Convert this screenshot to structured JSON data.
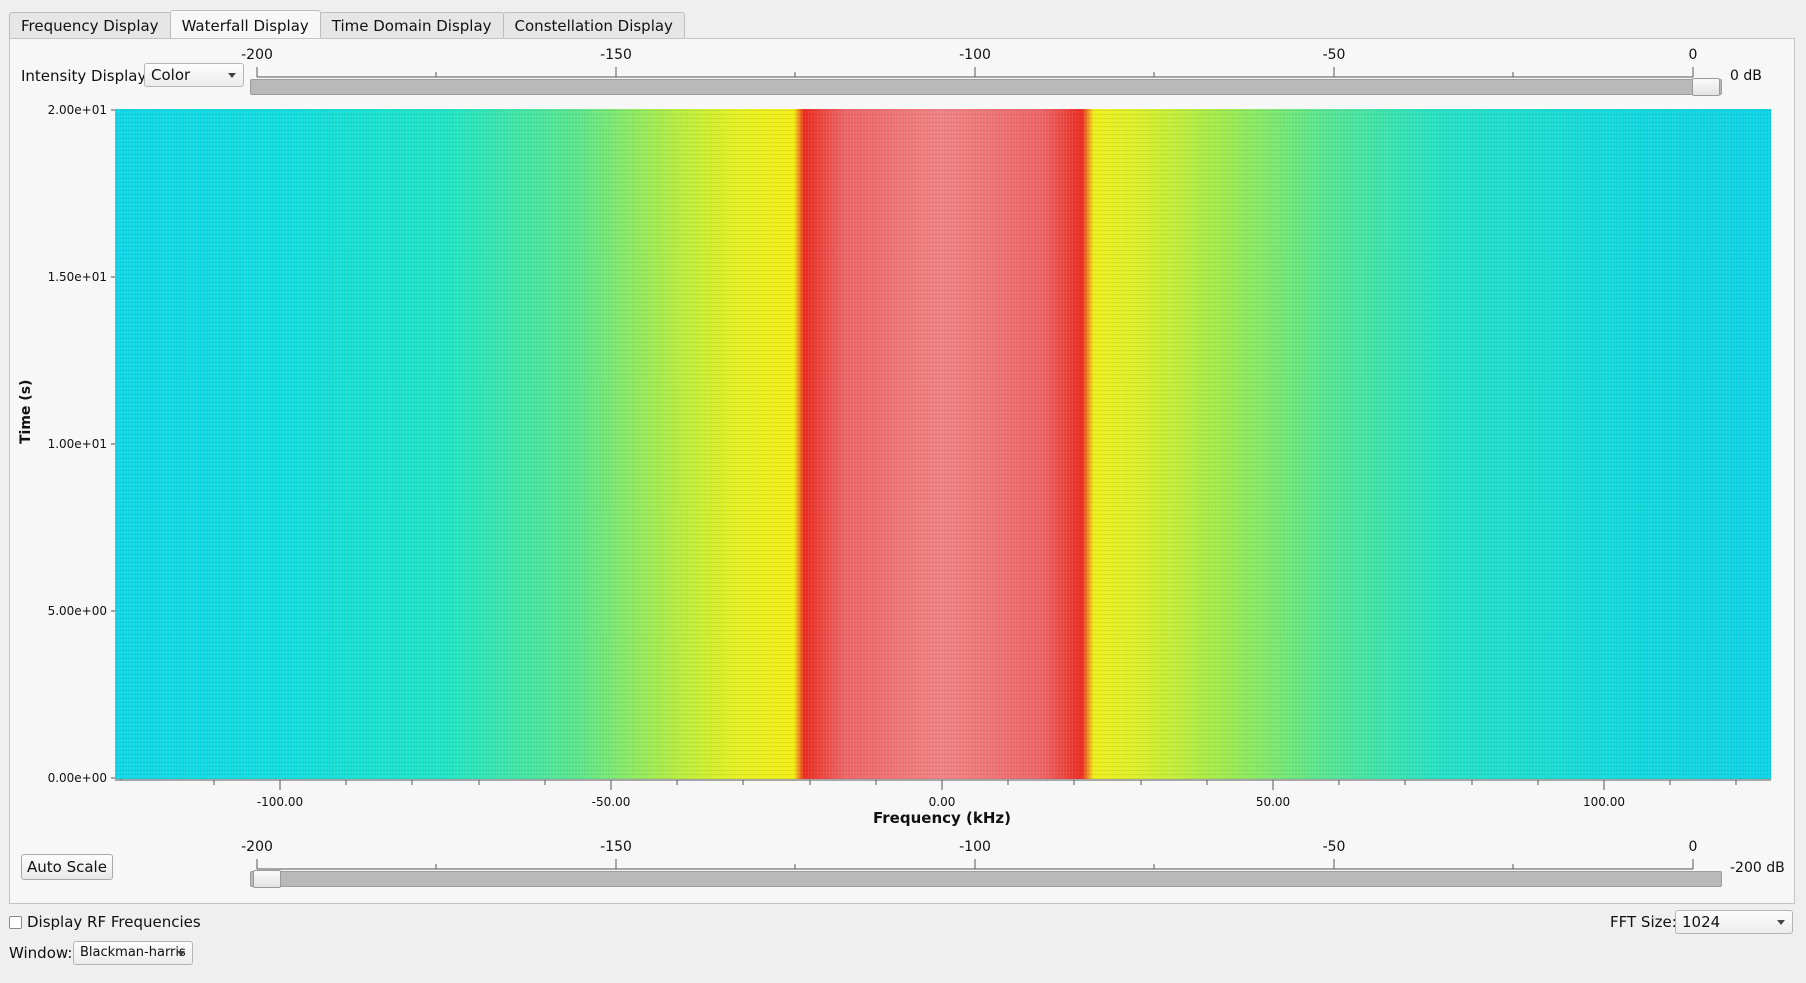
{
  "tabs": [
    {
      "label": "Frequency Display",
      "active": false
    },
    {
      "label": "Waterfall Display",
      "active": true
    },
    {
      "label": "Time Domain Display",
      "active": false
    },
    {
      "label": "Constellation Display",
      "active": false
    }
  ],
  "intensity": {
    "label": "Intensity Display:",
    "value": "Color"
  },
  "top_scale": {
    "ticks": [
      "-200",
      "-150",
      "-100",
      "-50",
      "0"
    ],
    "unit_label": "0 dB",
    "value": 0
  },
  "bottom_scale": {
    "ticks": [
      "-200",
      "-150",
      "-100",
      "-50",
      "0"
    ],
    "unit_label": "-200 dB",
    "value": -200
  },
  "plot": {
    "ylabel": "Time (s)",
    "xlabel": "Frequency (kHz)",
    "yticks": [
      "2.00e+01",
      "1.50e+01",
      "1.00e+01",
      "5.00e+00",
      "0.00e+00"
    ],
    "xticks": [
      "-100.00",
      "-50.00",
      "0.00",
      "50.00",
      "100.00"
    ],
    "colors": {
      "cyan": "#12dede",
      "yellow": "#f5ee12",
      "red": "#ee2a1e",
      "pink": "#f38282"
    }
  },
  "auto_scale_label": "Auto Scale",
  "rf_checkbox": {
    "label": "Display RF Frequencies",
    "checked": false
  },
  "window": {
    "label": "Window:",
    "value": "Blackman-harris"
  },
  "fft": {
    "label": "FFT Size:",
    "value": "1024"
  }
}
